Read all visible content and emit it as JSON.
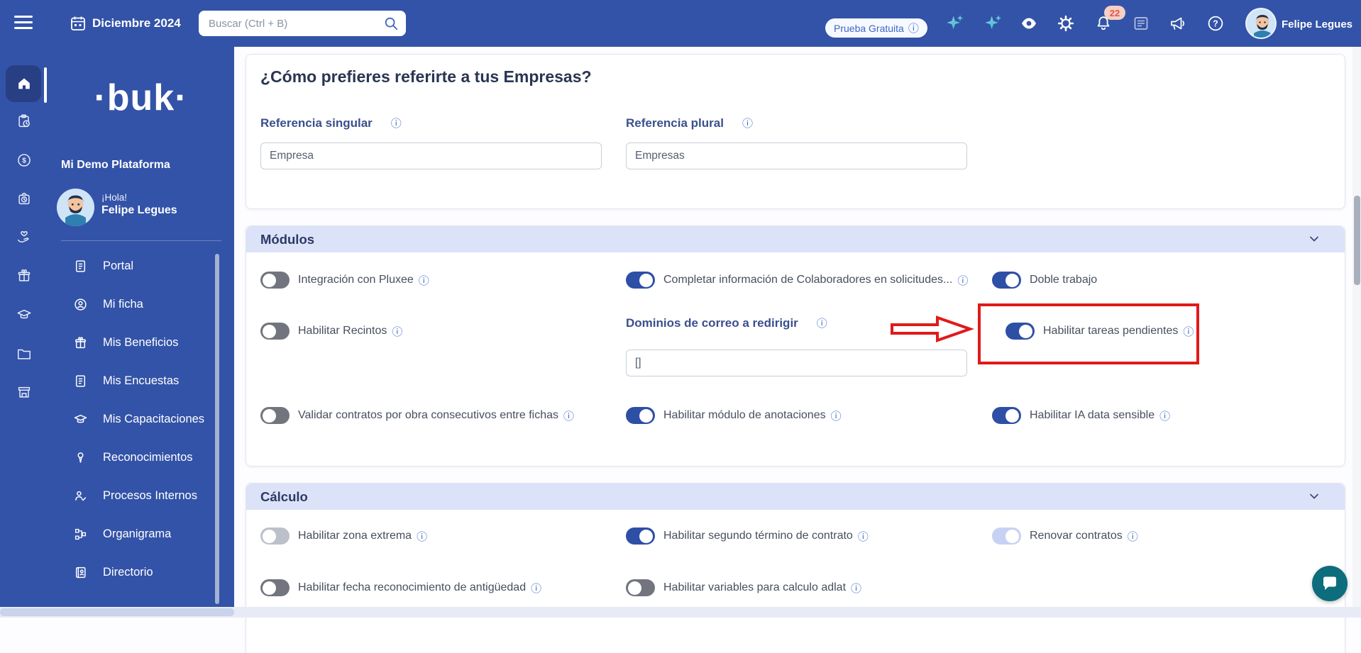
{
  "icons": {
    "info_glyph": "ⓘ"
  },
  "colors": {
    "accent": "#3353a8",
    "highlight_red": "#e01a1a",
    "band": "#dce3f8",
    "chat_teal": "#0d6d7c"
  },
  "topbar": {
    "month_label": "Diciembre 2024",
    "search_placeholder": "Buscar (Ctrl + B)",
    "trial_badge_label": "Prueba Gratuita",
    "notification_count": "22",
    "user_name": "Felipe Legues"
  },
  "sidebar": {
    "logo_text": "·buk·",
    "platform_name": "Mi Demo Plataforma",
    "greeting": "¡Hola!",
    "user_name": "Felipe Legues",
    "items": [
      {
        "icon": "document-icon",
        "label": "Portal"
      },
      {
        "icon": "person-circle-icon",
        "label": "Mi ficha"
      },
      {
        "icon": "gift-icon",
        "label": "Mis Beneficios"
      },
      {
        "icon": "document-icon",
        "label": "Mis Encuestas"
      },
      {
        "icon": "graduation-cap-icon",
        "label": "Mis Capacitaciones"
      },
      {
        "icon": "medal-icon",
        "label": "Reconocimientos"
      },
      {
        "icon": "person-check-icon",
        "label": "Procesos Internos"
      },
      {
        "icon": "org-chart-icon",
        "label": "Organigrama"
      },
      {
        "icon": "address-book-icon",
        "label": "Directorio"
      }
    ]
  },
  "rail": {
    "items": [
      {
        "icon": "home-icon",
        "active": true
      },
      {
        "icon": "clipboard-clock-icon"
      },
      {
        "icon": "coin-icon"
      },
      {
        "icon": "bag-clock-icon"
      },
      {
        "icon": "hand-heart-icon"
      },
      {
        "icon": "gift-icon"
      },
      {
        "icon": "graduation-cap-icon"
      },
      {
        "icon": "folder-icon"
      },
      {
        "icon": "storefront-icon"
      }
    ]
  },
  "main": {
    "section_title": "¿Cómo prefieres referirte a tus Empresas?",
    "fields": [
      {
        "label": "Referencia singular",
        "value": "Empresa"
      },
      {
        "label": "Referencia plural",
        "value": "Empresas"
      }
    ],
    "modules": {
      "title": "Módulos",
      "toggles": [
        {
          "label": "Integración con Pluxee",
          "state": "off",
          "info": true
        },
        {
          "label": "Completar información de Colaboradores en solicitudes...",
          "state": "on",
          "info": true
        },
        {
          "label": "Doble trabajo",
          "state": "on",
          "info": false
        },
        {
          "label": "Habilitar Recintos",
          "state": "off",
          "info": true
        },
        {
          "label": "Habilitar tareas pendientes",
          "state": "on",
          "info": true,
          "highlighted": true
        },
        {
          "label": "Validar contratos por obra consecutivos entre fichas",
          "state": "off",
          "info": true
        },
        {
          "label": "Habilitar módulo de anotaciones",
          "state": "on",
          "info": true
        },
        {
          "label": "Habilitar IA data sensible",
          "state": "on",
          "info": true
        }
      ],
      "domain_field": {
        "label": "Dominios de correo a redirigir",
        "value": "[]"
      }
    },
    "calculo": {
      "title": "Cálculo",
      "toggles": [
        {
          "label": "Habilitar zona extrema",
          "state": "off_light",
          "info": true
        },
        {
          "label": "Habilitar segundo término de contrato",
          "state": "on",
          "info": true
        },
        {
          "label": "Renovar contratos",
          "state": "on_pale",
          "info": true
        },
        {
          "label": "Habilitar fecha reconocimiento de antigüedad",
          "state": "off",
          "info": true
        },
        {
          "label": "Habilitar variables para calculo adlat",
          "state": "off",
          "info": true
        }
      ]
    }
  }
}
